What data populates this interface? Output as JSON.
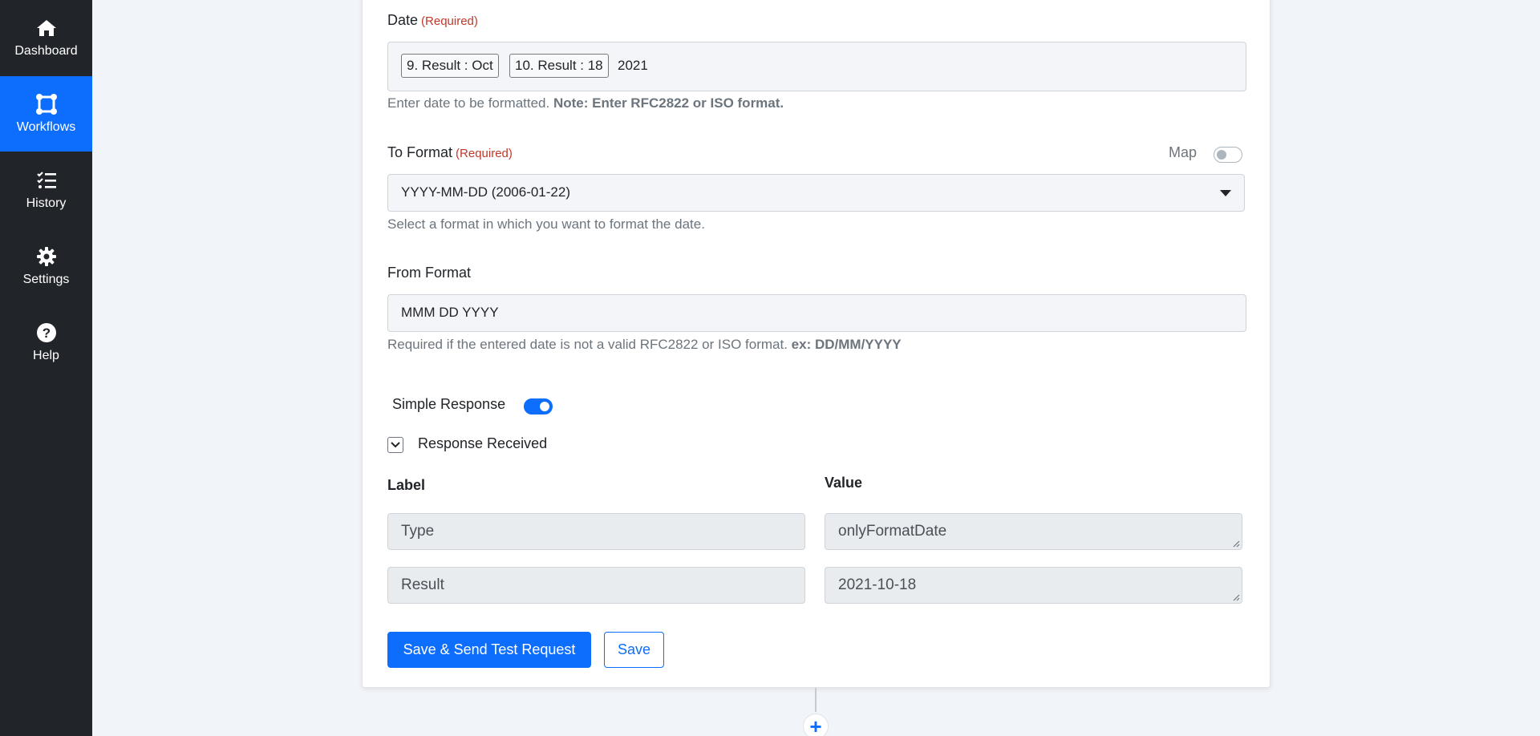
{
  "sidebar": {
    "items": [
      {
        "label": "Dashboard",
        "icon": "home-icon",
        "active": false
      },
      {
        "label": "Workflows",
        "icon": "workflow-icon",
        "active": true
      },
      {
        "label": "History",
        "icon": "history-list-icon",
        "active": false
      },
      {
        "label": "Settings",
        "icon": "gear-icon",
        "active": false
      },
      {
        "label": "Help",
        "icon": "question-circle-icon",
        "active": false
      }
    ]
  },
  "form": {
    "date": {
      "label": "Date",
      "required": "(Required)",
      "tokens": [
        "9. Result : Oct",
        "10. Result : 18"
      ],
      "year": "2021",
      "help": "Enter date to be formatted.",
      "help_note": "Note: Enter RFC2822 or ISO format."
    },
    "to_format": {
      "label": "To Format",
      "required": "(Required)",
      "map_label": "Map",
      "map_enabled": false,
      "selected": "YYYY-MM-DD (2006-01-22)",
      "help": "Select a format in which you want to format the date."
    },
    "from_format": {
      "label": "From Format",
      "value": "MMM DD YYYY",
      "help": "Required if the entered date is not a valid RFC2822 or ISO format.",
      "help_example": "ex: DD/MM/YYYY"
    },
    "simple_response": {
      "label": "Simple Response",
      "enabled": true
    },
    "response_received": {
      "label": "Response Received",
      "label_header": "Label",
      "value_header": "Value",
      "rows": [
        {
          "label": "Type",
          "value": "onlyFormatDate"
        },
        {
          "label": "Result",
          "value": "2021-10-18"
        }
      ]
    },
    "buttons": {
      "save_send": "Save & Send Test Request",
      "save": "Save"
    }
  },
  "add_step": {
    "symbol": "+"
  },
  "colors": {
    "primary": "#0d6efd",
    "sidebar_bg": "#212529",
    "required": "#c0392b"
  }
}
